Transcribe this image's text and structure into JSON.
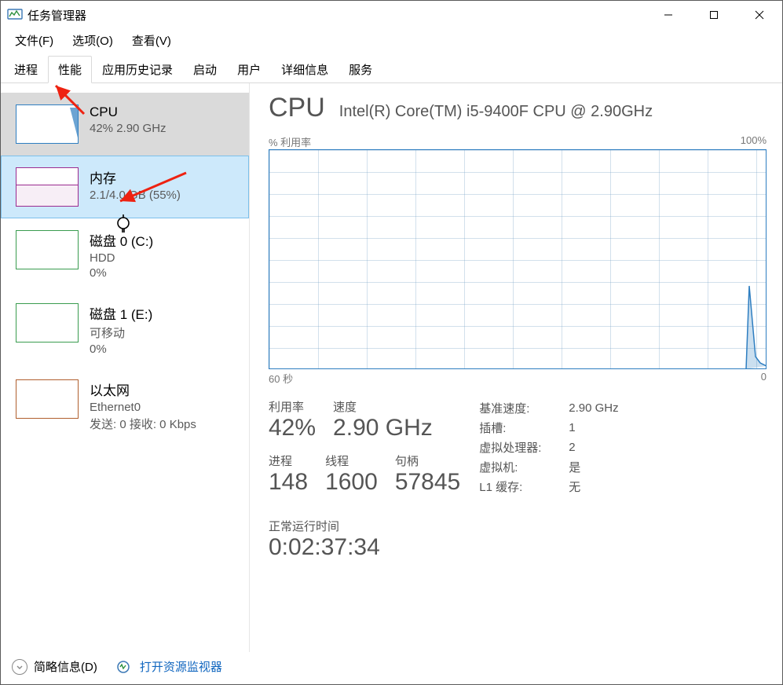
{
  "window": {
    "title": "任务管理器"
  },
  "menu": {
    "file": "文件(F)",
    "options": "选项(O)",
    "view": "查看(V)"
  },
  "tabs": {
    "processes": "进程",
    "performance": "性能",
    "appHistory": "应用历史记录",
    "startup": "启动",
    "users": "用户",
    "details": "详细信息",
    "services": "服务"
  },
  "side": {
    "cpu": {
      "title": "CPU",
      "sub": "42% 2.90 GHz"
    },
    "mem": {
      "title": "内存",
      "sub": "2.1/4.0 GB (55%)"
    },
    "diskC": {
      "title": "磁盘 0 (C:)",
      "sub": "HDD",
      "pct": "0%"
    },
    "diskE": {
      "title": "磁盘 1 (E:)",
      "sub": "可移动",
      "pct": "0%"
    },
    "eth": {
      "title": "以太网",
      "sub": "Ethernet0",
      "line3": "发送: 0 接收: 0 Kbps"
    }
  },
  "detail": {
    "header": "CPU",
    "model": "Intel(R) Core(TM) i5-9400F CPU @ 2.90GHz",
    "graph": {
      "ylabel": "% 利用率",
      "ymax": "100%",
      "xmin": "60 秒",
      "xmax": "0"
    },
    "stats": {
      "util": {
        "label": "利用率",
        "value": "42%"
      },
      "speed": {
        "label": "速度",
        "value": "2.90 GHz"
      },
      "procs": {
        "label": "进程",
        "value": "148"
      },
      "threads": {
        "label": "线程",
        "value": "1600"
      },
      "handles": {
        "label": "句柄",
        "value": "57845"
      }
    },
    "right": {
      "baseSpeedK": "基准速度:",
      "baseSpeedV": "2.90 GHz",
      "socketsK": "插槽:",
      "socketsV": "1",
      "vprocsK": "虚拟处理器:",
      "vprocsV": "2",
      "vmK": "虚拟机:",
      "vmV": "是",
      "l1K": "L1 缓存:",
      "l1V": "无"
    },
    "uptime": {
      "label": "正常运行时间",
      "value": "0:02:37:34"
    }
  },
  "footer": {
    "simple": "简略信息(D)",
    "resmon": "打开资源监视器"
  },
  "chart_data": {
    "type": "line",
    "title": "% 利用率",
    "ylabel": "% 利用率",
    "ylim": [
      0,
      100
    ],
    "xlabel_left": "60 秒",
    "xlabel_right": "0",
    "x_seconds_ago": [
      60,
      55,
      50,
      45,
      40,
      35,
      30,
      25,
      20,
      15,
      10,
      5,
      4,
      3,
      2,
      1,
      0
    ],
    "values": [
      0,
      0,
      0,
      0,
      0,
      0,
      0,
      0,
      0,
      0,
      0,
      0,
      0,
      45,
      10,
      6,
      4
    ]
  }
}
